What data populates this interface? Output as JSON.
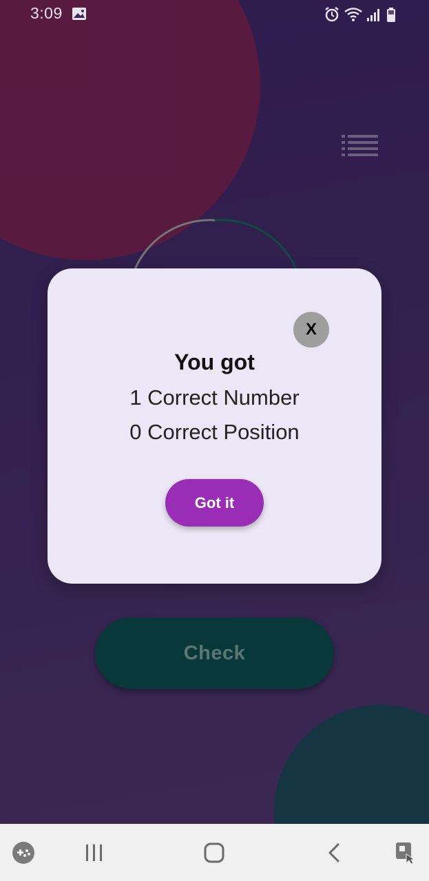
{
  "status_bar": {
    "time": "3:09",
    "left_icons": [
      "image-icon"
    ],
    "right_icons": [
      "alarm-icon",
      "wifi-icon",
      "signal-icon",
      "battery-icon"
    ]
  },
  "background": {
    "menu_icon": "list-menu-icon",
    "colors": {
      "red_blob": "#671e45",
      "teal_blob": "#173f4a",
      "background": "#362257"
    }
  },
  "check_button": {
    "label": "Check",
    "color": "#05423e"
  },
  "dialog": {
    "close_label": "X",
    "title": "You got",
    "line1": "1 Correct Number",
    "line2": "0 Correct Position",
    "confirm_label": "Got it",
    "confirm_color": "#9a2db5"
  },
  "nav_bar": {
    "items": [
      "game-launcher-icon",
      "recent-apps-icon",
      "home-icon",
      "back-icon",
      "assistive-touch-icon"
    ]
  }
}
